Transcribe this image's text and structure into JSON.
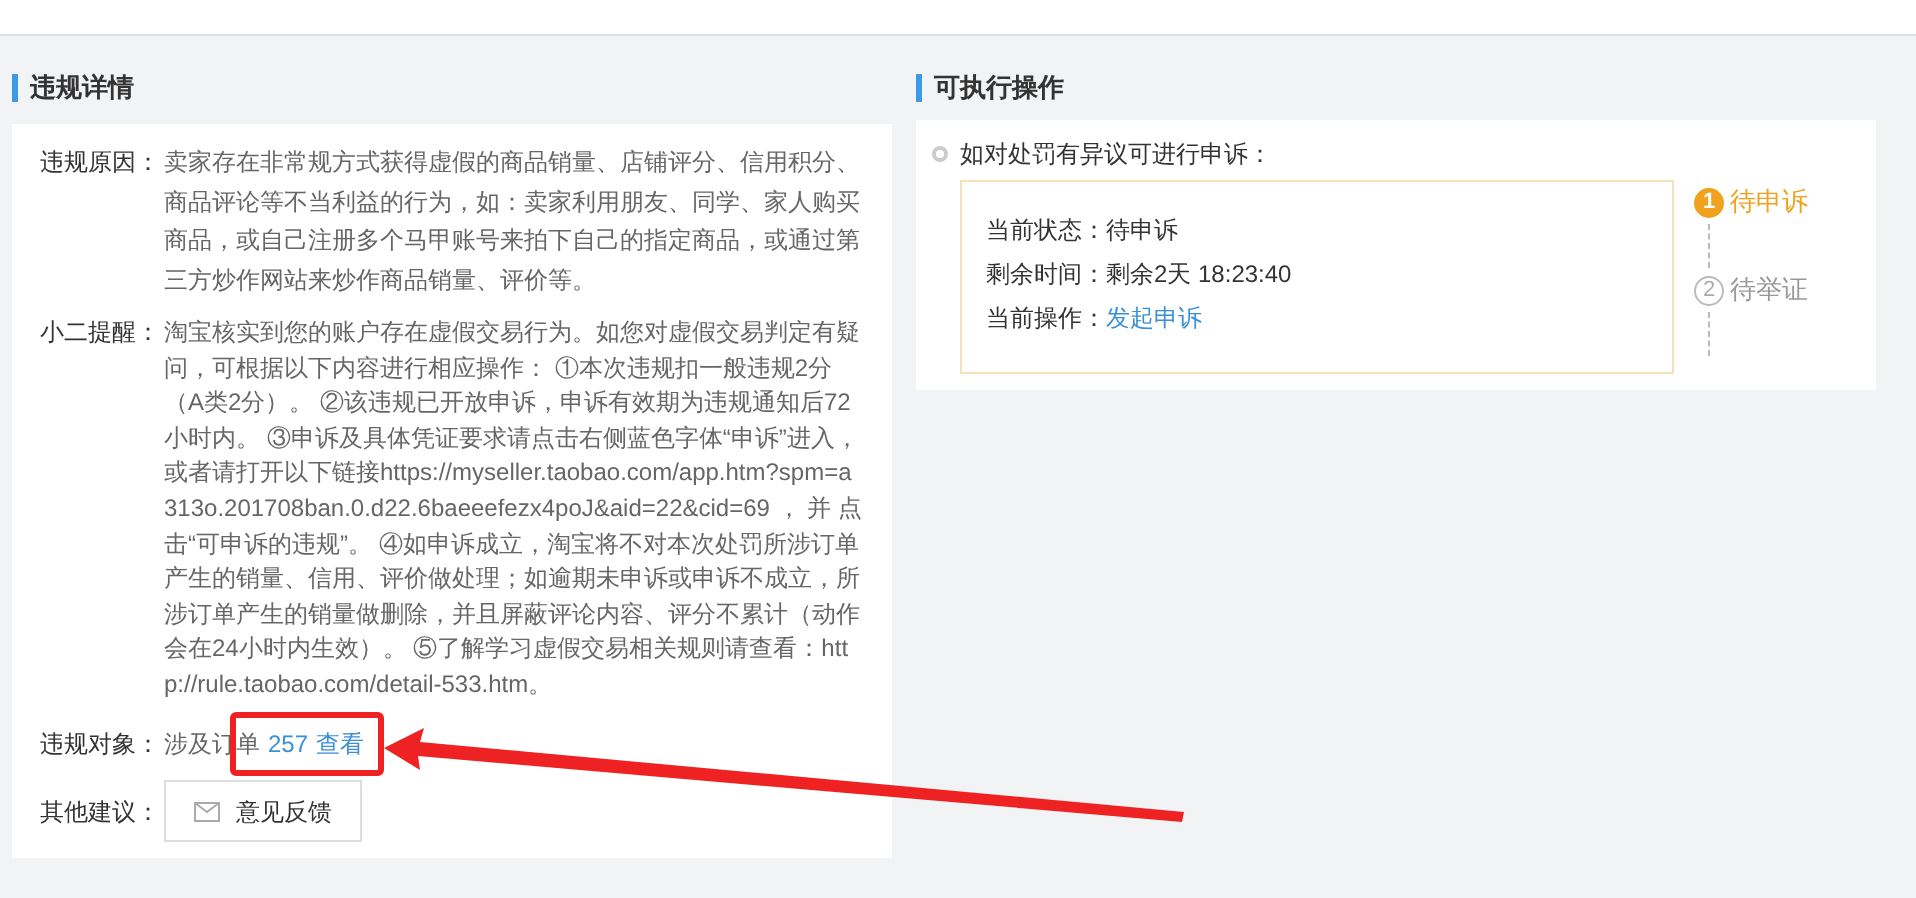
{
  "details": {
    "title": "违规详情",
    "rows": [
      {
        "kind": "text",
        "label": "违规原因：",
        "text": "卖家存在非常规方式获得虚假的商品销量、店铺评分、信用积分、商品评论等不当利益的行为，如：卖家利用朋友、同学、家人购买商品，或自己注册多个马甲账号来拍下自己的指定商品，或通过第三方炒作网站来炒作商品销量、评价等。"
      },
      {
        "kind": "text",
        "label": "小二提醒：",
        "text": "淘宝核实到您的账户存在虚假交易行为。如您对虚假交易判定有疑问，可根据以下内容进行相应操作： ①本次违规扣一般违规2分（A类2分）。 ②该违规已开放申诉，申诉有效期为违规通知后72小时内。 ③申诉及具体凭证要求请点击右侧蓝色字体“申诉”进入，或者请打开以下链接https://myseller.taobao.com/app.htm?spm=a313o.201708ban.0.d22.6baeeefezx4poJ&aid=22&cid=69 ， 并 点击“可申诉的违规”。 ④如申诉成立，淘宝将不对本次处罚所涉订单产生的销量、信用、评价做处理；如逾期未申诉或申诉不成立，所涉订单产生的销量做删除，并且屏蔽评论内容、评分不累计（动作会在24小时内生效）。 ⑤了解学习虚假交易相关规则请查看：http://rule.taobao.com/detail-533.htm。"
      },
      {
        "kind": "orders",
        "label": "违规对象：",
        "prefix": "涉及订单",
        "count": "257",
        "link": "查看"
      },
      {
        "kind": "button",
        "label": "其他建议：",
        "button": "意见反馈"
      }
    ]
  },
  "actions": {
    "title": "可执行操作",
    "intro": "如对处罚有异议可进行申诉：",
    "fields": [
      {
        "kind": "text",
        "label": "当前状态：",
        "value": "待申诉"
      },
      {
        "kind": "text",
        "label": "剩余时间：",
        "value": "剩余2天 18:23:40"
      },
      {
        "kind": "link",
        "label": "当前操作：",
        "value": "发起申诉"
      }
    ],
    "steps": [
      {
        "number": "1",
        "label": "待申诉",
        "selected": true
      },
      {
        "number": "2",
        "label": "待举证",
        "selected": false
      }
    ]
  }
}
